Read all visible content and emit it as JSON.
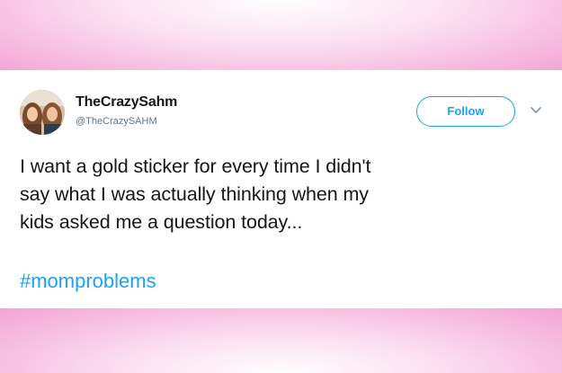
{
  "tweet": {
    "display_name": "TheCrazySahm",
    "handle": "@TheCrazySAHM",
    "follow_label": "Follow",
    "text_lines": [
      "I want a gold sticker for every time I didn't",
      "say what I was actually thinking when my",
      "kids asked me a question today..."
    ],
    "hashtag": "#momproblems"
  },
  "colors": {
    "accent": "#1da1f2",
    "text": "#14171a",
    "muted": "#657786",
    "background_pink": "#f08fcb"
  },
  "icons": {
    "avatar": "profile-photo",
    "chevron": "chevron-down-icon"
  }
}
